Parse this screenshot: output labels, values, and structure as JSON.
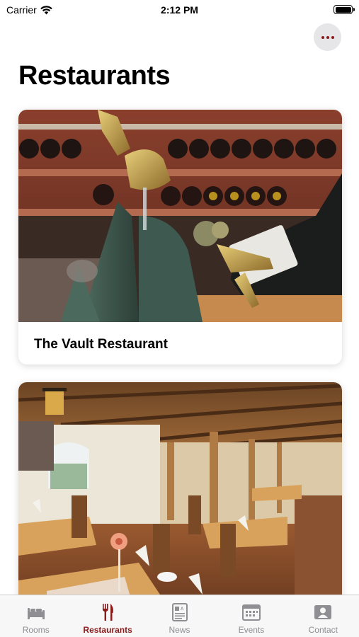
{
  "status": {
    "carrier": "Carrier",
    "time": "2:12 PM"
  },
  "header": {
    "title": "Restaurants"
  },
  "cards": [
    {
      "title": "The Vault Restaurant"
    },
    {
      "title": ""
    }
  ],
  "tabs": [
    {
      "label": "Rooms",
      "icon": "bed-icon"
    },
    {
      "label": "Restaurants",
      "icon": "fork-knife-icon"
    },
    {
      "label": "News",
      "icon": "newspaper-icon"
    },
    {
      "label": "Events",
      "icon": "calendar-icon"
    },
    {
      "label": "Contact",
      "icon": "contact-card-icon"
    }
  ],
  "colors": {
    "accent": "#8b1a1a",
    "inactive": "#8e8e93"
  }
}
